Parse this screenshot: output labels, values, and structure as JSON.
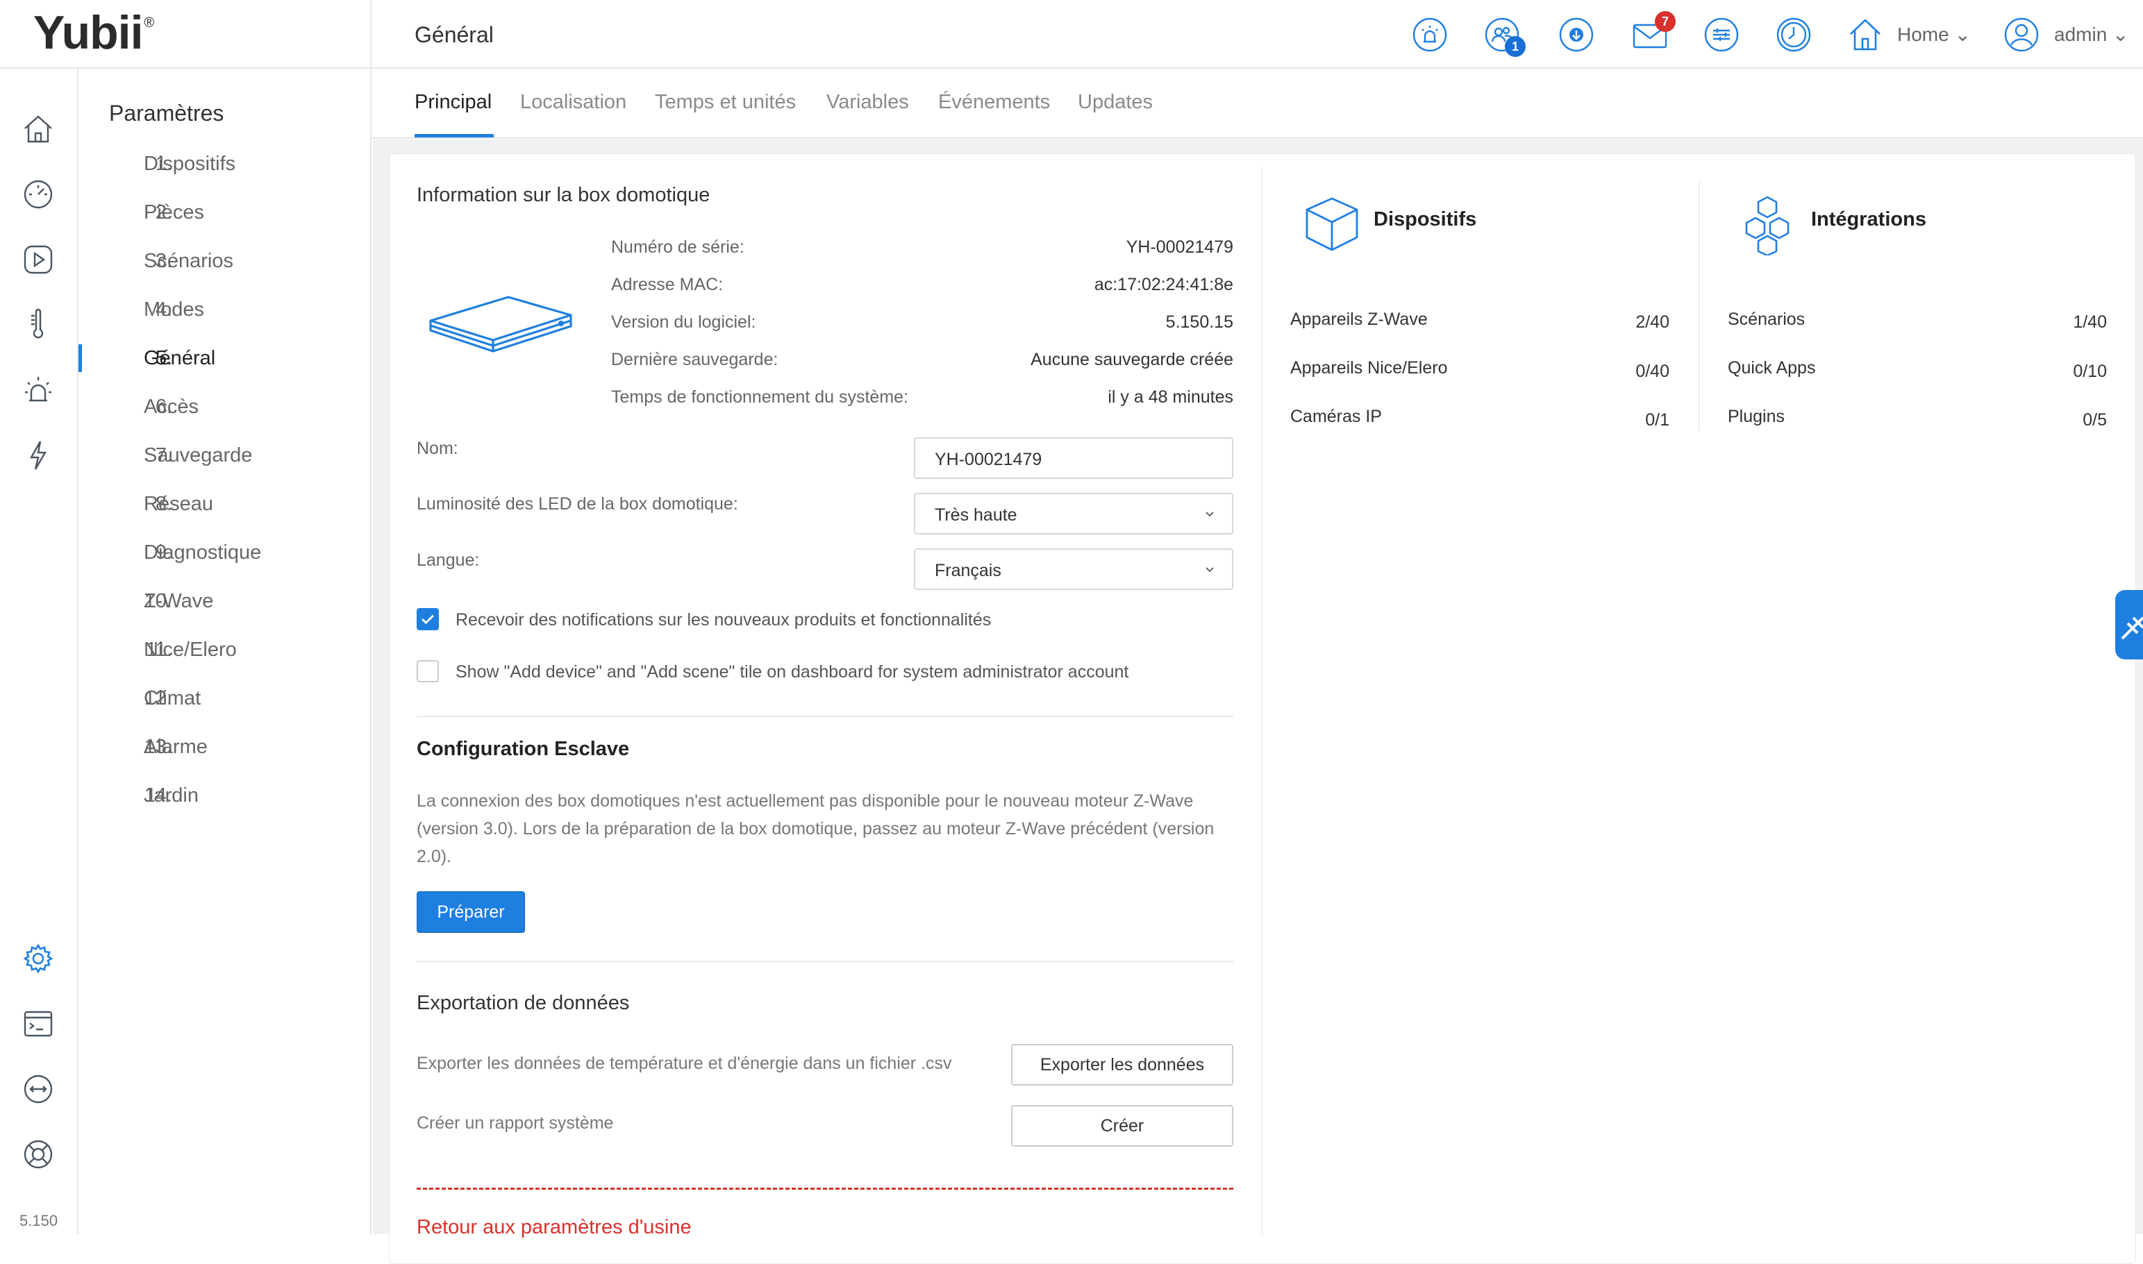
{
  "app": {
    "logo": "Yubii",
    "logo_mark": "®",
    "page_title": "Général",
    "version": "5.150"
  },
  "header": {
    "users_badge": "1",
    "mail_badge": "7",
    "home_label": "Home",
    "user_label": "admin"
  },
  "settings_nav": {
    "title": "Paramètres",
    "items": [
      {
        "num": "1.",
        "label": "Dispositifs"
      },
      {
        "num": "2.",
        "label": "Pièces"
      },
      {
        "num": "3.",
        "label": "Scénarios"
      },
      {
        "num": "4.",
        "label": "Modes"
      },
      {
        "num": "5.",
        "label": "Général"
      },
      {
        "num": "6.",
        "label": "Accès"
      },
      {
        "num": "7.",
        "label": "Sauvegarde"
      },
      {
        "num": "8.",
        "label": "Réseau"
      },
      {
        "num": "9.",
        "label": "Diagnostique"
      },
      {
        "num": "10.",
        "label": "Z-Wave"
      },
      {
        "num": "11.",
        "label": "Nice/Elero"
      },
      {
        "num": "12.",
        "label": "Climat"
      },
      {
        "num": "13.",
        "label": "Alarme"
      },
      {
        "num": "14.",
        "label": "Jardin"
      }
    ]
  },
  "tabs": [
    "Principal",
    "Localisation",
    "Temps et unités",
    "Variables",
    "Événements",
    "Updates"
  ],
  "box_info": {
    "title": "Information sur la box domotique",
    "rows": [
      {
        "label": "Numéro de série:",
        "value": "YH-00021479"
      },
      {
        "label": "Adresse MAC:",
        "value": "ac:17:02:24:41:8e"
      },
      {
        "label": "Version du logiciel:",
        "value": "5.150.15"
      },
      {
        "label": "Dernière sauvegarde:",
        "value": "Aucune sauvegarde créée"
      },
      {
        "label": "Temps de fonctionnement du système:",
        "value": "il y a 48 minutes"
      }
    ]
  },
  "form": {
    "name_label": "Nom:",
    "name_value": "YH-00021479",
    "led_label": "Luminosité des LED de la box domotique:",
    "led_value": "Très haute",
    "lang_label": "Langue:",
    "lang_value": "Français",
    "notify_label": "Recevoir des notifications sur les nouveaux produits et fonctionnalités",
    "notify_checked": true,
    "tile_label": "Show \"Add device\" and \"Add scene\" tile on dashboard for system administrator account",
    "tile_checked": false
  },
  "slave": {
    "title": "Configuration Esclave",
    "text": "La connexion des box domotiques n'est actuellement pas disponible pour le nouveau moteur Z-Wave (version 3.0). Lors de la préparation de la box domotique, passez au moteur Z-Wave précédent (version 2.0).",
    "button": "Préparer"
  },
  "export": {
    "title": "Exportation de données",
    "csv_label": "Exporter les données de température et d'énergie dans un fichier .csv",
    "csv_button": "Exporter les données",
    "report_label": "Créer un rapport système",
    "report_button": "Créer"
  },
  "factory_reset_title": "Retour aux paramètres d'usine",
  "devices_panel": {
    "title": "Dispositifs",
    "rows": [
      {
        "label": "Appareils Z-Wave",
        "value": "2/40"
      },
      {
        "label": "Appareils Nice/Elero",
        "value": "0/40"
      },
      {
        "label": "Caméras IP",
        "value": "0/1"
      }
    ]
  },
  "integrations_panel": {
    "title": "Intégrations",
    "rows": [
      {
        "label": "Scénarios",
        "value": "1/40"
      },
      {
        "label": "Quick Apps",
        "value": "0/10"
      },
      {
        "label": "Plugins",
        "value": "0/5"
      }
    ]
  },
  "colors": {
    "accent": "#1f7fe0",
    "danger": "#d9312c",
    "badge_blue": "#1a6fd6"
  }
}
